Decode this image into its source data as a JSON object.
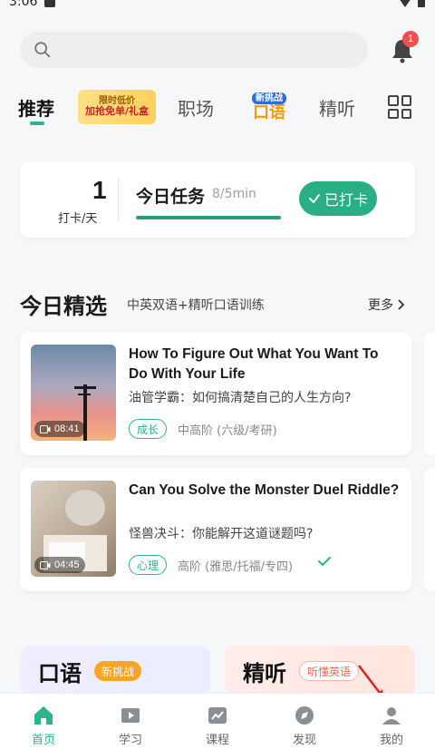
{
  "status": {
    "time": "3:06"
  },
  "search": {
    "placeholder": ""
  },
  "notifications": {
    "count": "1"
  },
  "tabs": [
    {
      "label": "推荐"
    },
    {
      "top": "限时低价",
      "bottom": "加抢免单/礼盒"
    },
    {
      "label": "职场"
    },
    {
      "top": "新挑战",
      "bottom": "口语"
    },
    {
      "label": "精听"
    }
  ],
  "task": {
    "streak_num": "1",
    "streak_label": "打卡/天",
    "title": "今日任务",
    "progress_text": "8/5min",
    "progress_fraction": 1.0,
    "checkin_label": "已打卡"
  },
  "section": {
    "title": "今日精选",
    "subtitle": "中英双语+精听口语训练",
    "more": "更多"
  },
  "cards": [
    {
      "title": "How To Figure Out What You Want To Do With Your Life",
      "cn": "油管学霸：如何搞清楚自己的人生方向?",
      "tag": "成长",
      "level": "中高阶 (六级/考研)",
      "duration": "08:41"
    },
    {
      "title": "Can You Solve the Monster Duel Riddle?",
      "cn": "怪兽决斗：你能解开这道谜题吗?",
      "tag": "心理",
      "level": "高阶 (雅思/托福/专四)",
      "duration": "04:45"
    }
  ],
  "promos": {
    "left": {
      "title": "口语",
      "chip": "新挑战"
    },
    "right": {
      "title": "精听",
      "chip": "听懂英语"
    }
  },
  "nav": [
    {
      "label": "首页"
    },
    {
      "label": "学习"
    },
    {
      "label": "课程"
    },
    {
      "label": "发现"
    },
    {
      "label": "我的"
    }
  ],
  "colors": {
    "accent": "#2bb38b",
    "badge": "#f05050"
  }
}
